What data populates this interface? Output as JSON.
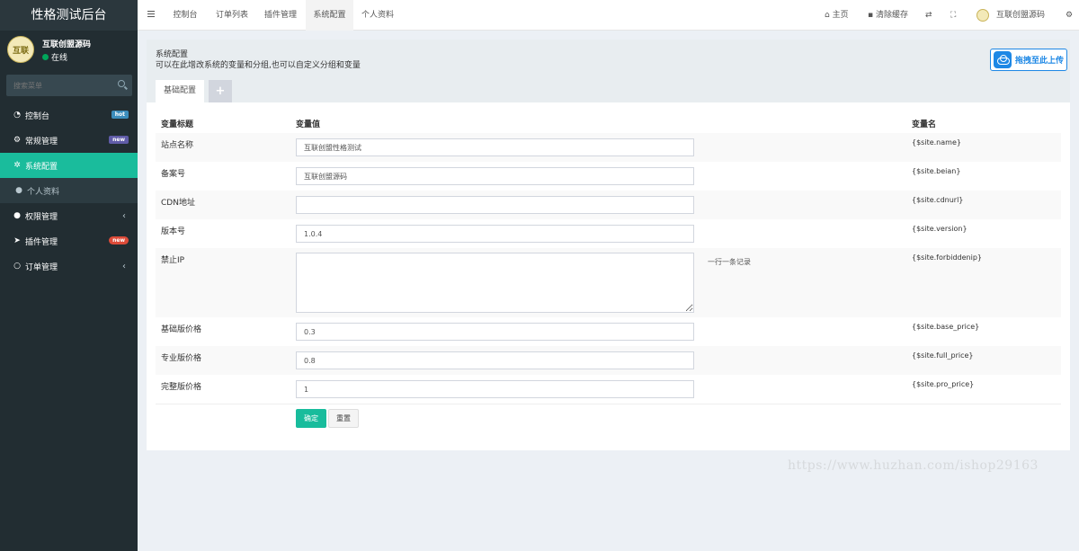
{
  "app_title": "性格测试后台",
  "user": {
    "name": "互联创盟源码",
    "status": "在线",
    "avatar_text": "互联"
  },
  "search": {
    "placeholder": "搜索菜单"
  },
  "menu": [
    {
      "label": "控制台",
      "icon": "dashboard-icon",
      "badge": "hot"
    },
    {
      "label": "常规管理",
      "icon": "cogs-icon",
      "badge": "new"
    },
    {
      "label": "系统配置",
      "icon": "gear-icon",
      "active": true
    },
    {
      "label": "个人资料",
      "icon": "user-icon",
      "sub": true
    },
    {
      "label": "权限管理",
      "icon": "group-icon",
      "chevron": "‹"
    },
    {
      "label": "插件管理",
      "icon": "rocket-icon",
      "badge": "new"
    },
    {
      "label": "订单管理",
      "icon": "circle-icon",
      "chevron": "‹"
    }
  ],
  "topbar": {
    "tabs": [
      "控制台",
      "订单列表",
      "插件管理",
      "系统配置",
      "个人资料"
    ],
    "home": "主页",
    "clear_cache": "清除缓存",
    "user_name": "互联创盟源码"
  },
  "content": {
    "title": "系统配置",
    "description": "可以在此增改系统的变量和分组,也可以自定义分组和变量",
    "upload_label": "拖拽至此上传",
    "tab_basic": "基础配置",
    "tab_add": "+",
    "columns": [
      "变量标题",
      "变量值",
      "变量名"
    ],
    "rows": [
      {
        "label": "站点名称",
        "value": "互联创盟性格测试",
        "name": "{$site.name}"
      },
      {
        "label": "备案号",
        "value": "互联创盟源码",
        "name": "{$site.beian}"
      },
      {
        "label": "CDN地址",
        "value": "",
        "name": "{$site.cdnurl}"
      },
      {
        "label": "版本号",
        "value": "1.0.4",
        "name": "{$site.version}"
      },
      {
        "label": "禁止IP",
        "value": "",
        "name": "{$site.forbiddenip}",
        "hint": "一行一条记录"
      },
      {
        "label": "基础版价格",
        "value": "0.3",
        "name": "{$site.base_price}"
      },
      {
        "label": "专业版价格",
        "value": "0.8",
        "name": "{$site.full_price}"
      },
      {
        "label": "完整版价格",
        "value": "1",
        "name": "{$site.pro_price}"
      }
    ],
    "submit_label": "确定",
    "reset_label": "重置"
  },
  "watermark": "https://www.huzhan.com/ishop29163"
}
